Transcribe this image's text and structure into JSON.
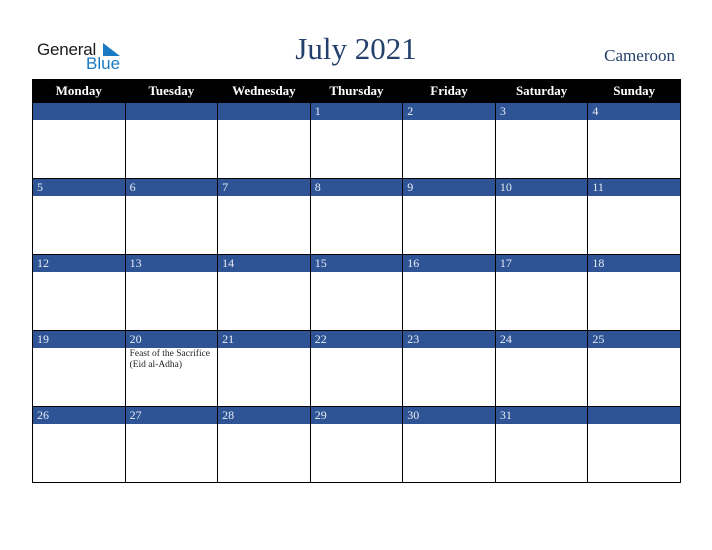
{
  "logo": {
    "line1": "General",
    "line2": "Blue"
  },
  "title": "July 2021",
  "country": "Cameroon",
  "colors": {
    "header_bg": "#000000",
    "date_bar": "#2E5496",
    "title": "#233F6B",
    "logo_blue": "#1A7BC4"
  },
  "weekdays": [
    "Monday",
    "Tuesday",
    "Wednesday",
    "Thursday",
    "Friday",
    "Saturday",
    "Sunday"
  ],
  "weeks": [
    [
      {
        "day": ""
      },
      {
        "day": ""
      },
      {
        "day": ""
      },
      {
        "day": "1"
      },
      {
        "day": "2"
      },
      {
        "day": "3"
      },
      {
        "day": "4"
      }
    ],
    [
      {
        "day": "5"
      },
      {
        "day": "6"
      },
      {
        "day": "7"
      },
      {
        "day": "8"
      },
      {
        "day": "9"
      },
      {
        "day": "10"
      },
      {
        "day": "11"
      }
    ],
    [
      {
        "day": "12"
      },
      {
        "day": "13"
      },
      {
        "day": "14"
      },
      {
        "day": "15"
      },
      {
        "day": "16"
      },
      {
        "day": "17"
      },
      {
        "day": "18"
      }
    ],
    [
      {
        "day": "19"
      },
      {
        "day": "20",
        "event": "Feast of the Sacrifice (Eid al-Adha)"
      },
      {
        "day": "21"
      },
      {
        "day": "22"
      },
      {
        "day": "23"
      },
      {
        "day": "24"
      },
      {
        "day": "25"
      }
    ],
    [
      {
        "day": "26"
      },
      {
        "day": "27"
      },
      {
        "day": "28"
      },
      {
        "day": "29"
      },
      {
        "day": "30"
      },
      {
        "day": "31"
      },
      {
        "day": ""
      }
    ]
  ]
}
